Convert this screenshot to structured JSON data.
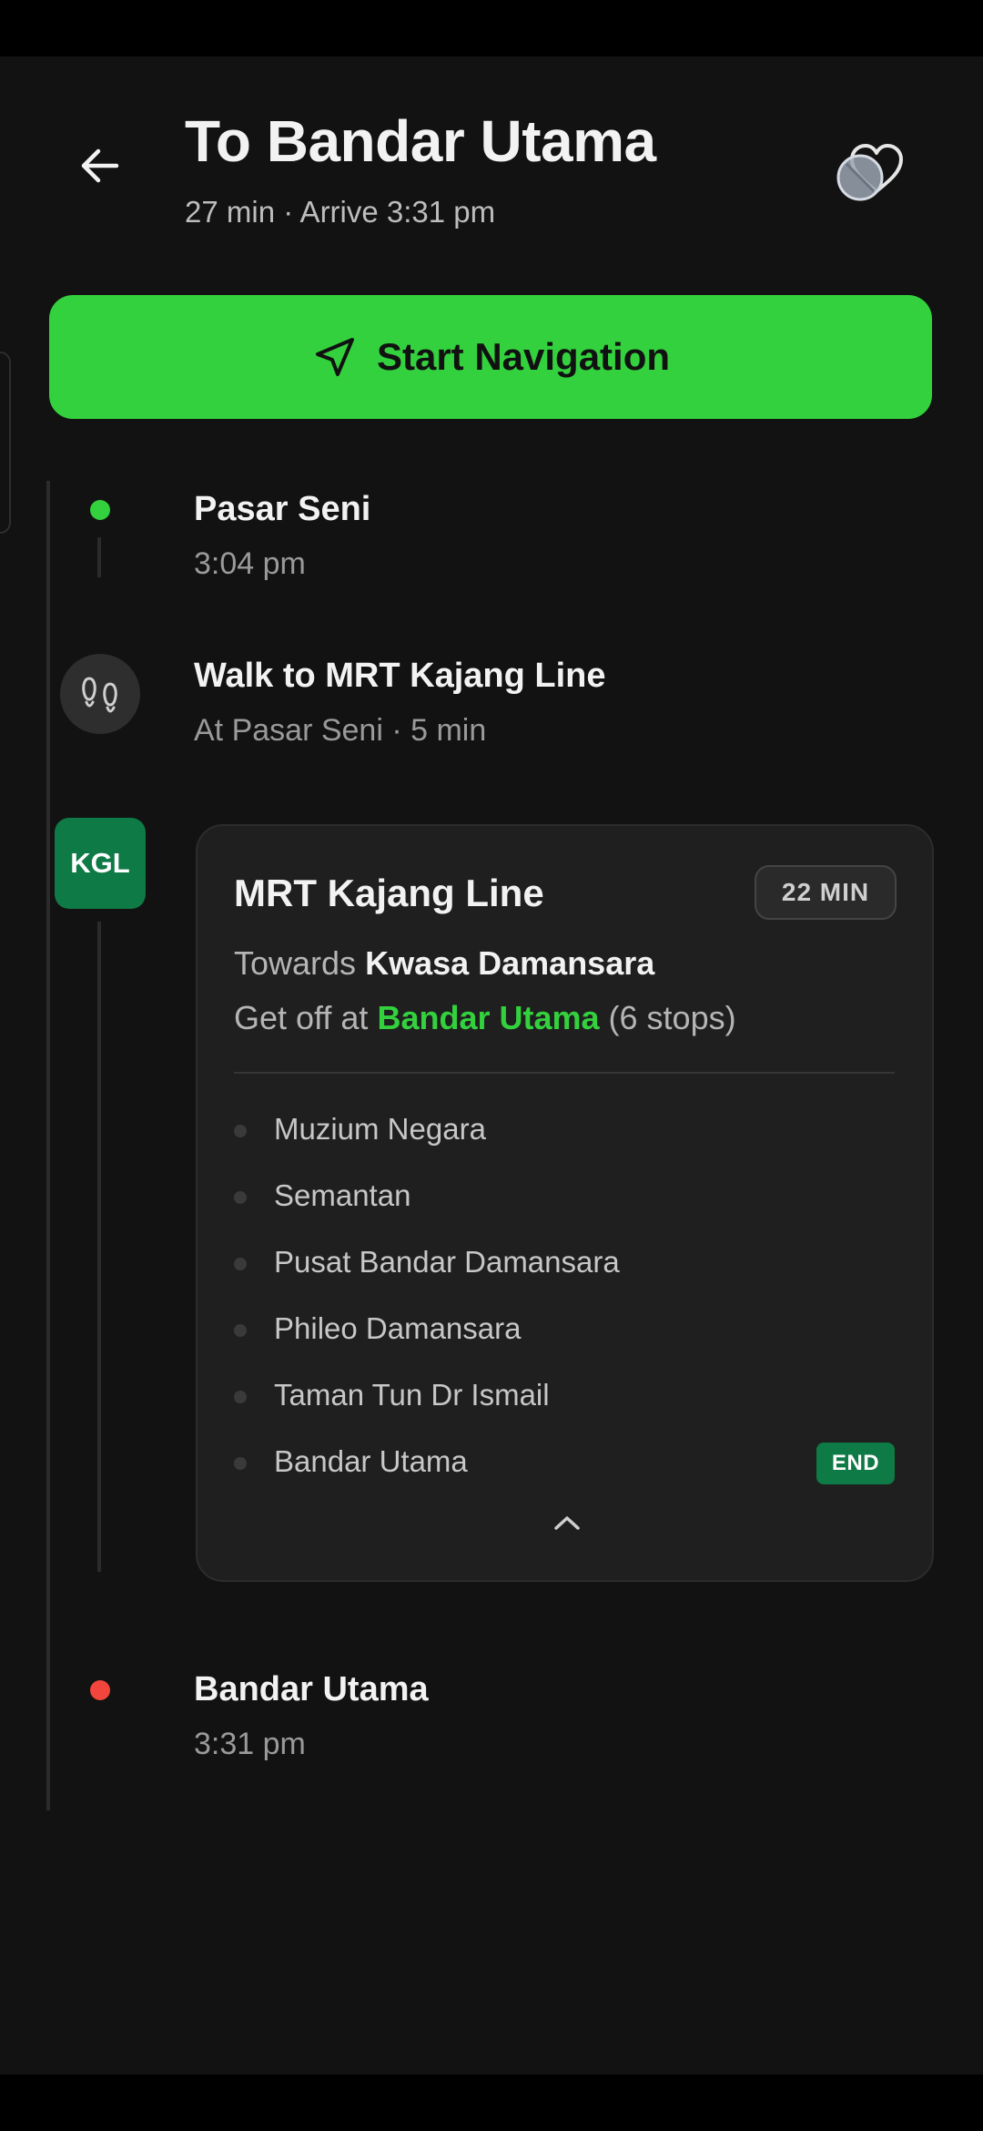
{
  "header": {
    "title": "To Bandar Utama",
    "subtitle": "27 min · Arrive 3:31 pm",
    "back_icon": "arrow-left-icon",
    "favorite_icon": "heart-icon"
  },
  "start_button": {
    "label": "Start Navigation",
    "icon": "navigation-arrow-icon",
    "color": "#33d13d"
  },
  "timeline": {
    "origin": {
      "name": "Pasar Seni",
      "time": "3:04 pm",
      "dot_color": "#33d13d"
    },
    "walk": {
      "title": "Walk to MRT Kajang Line",
      "detail": "At Pasar Seni · 5 min",
      "icon": "footsteps-icon"
    },
    "transit": {
      "badge": "KGL",
      "badge_color": "#0e7a45",
      "line_name": "MRT Kajang Line",
      "duration": "22 MIN",
      "towards_prefix": "Towards",
      "towards": "Kwasa Damansara",
      "getoff_prefix": "Get off at",
      "getoff_station": "Bandar Utama",
      "stop_count": "(6 stops)",
      "stops": [
        {
          "name": "Muzium Negara"
        },
        {
          "name": "Semantan"
        },
        {
          "name": "Pusat Bandar Damansara"
        },
        {
          "name": "Phileo Damansara"
        },
        {
          "name": "Taman Tun Dr Ismail"
        },
        {
          "name": "Bandar Utama",
          "badge": "END"
        }
      ],
      "collapse_icon": "chevron-up-icon"
    },
    "destination": {
      "name": "Bandar Utama",
      "time": "3:31 pm",
      "dot_color": "#f2463c"
    }
  }
}
